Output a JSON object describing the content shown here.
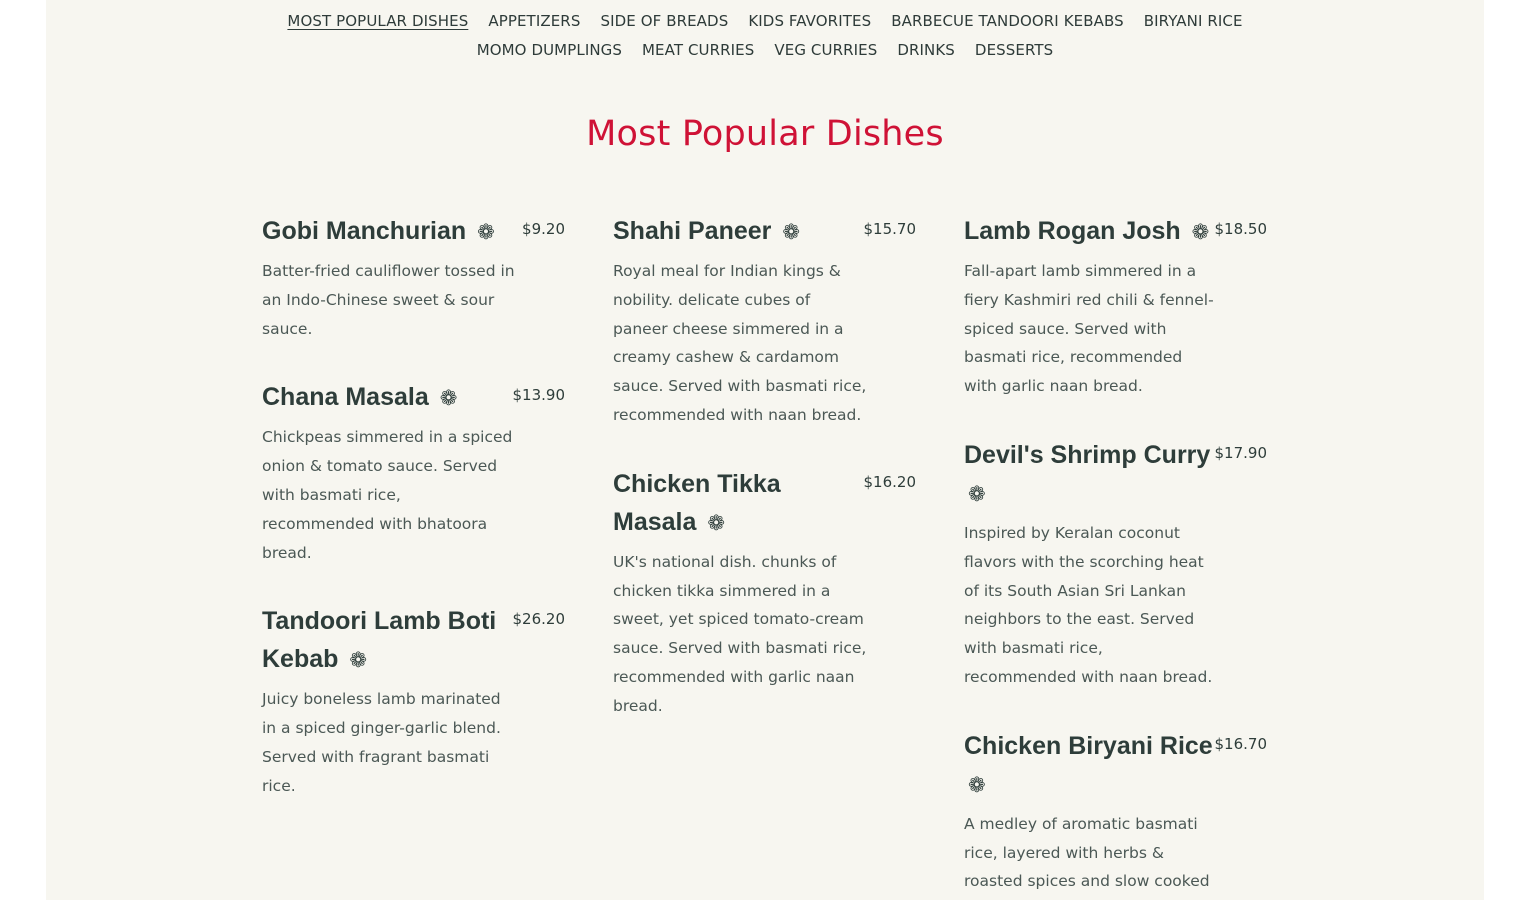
{
  "nav": {
    "row1": [
      "MOST POPULAR DISHES",
      "APPETIZERS",
      "SIDE OF BREADS",
      "KIDS FAVORITES",
      "BARBECUE TANDOORI KEBABS",
      "BIRYANI RICE"
    ],
    "row2": [
      "MOMO DUMPLINGS",
      "MEAT CURRIES",
      "VEG CURRIES",
      "DRINKS",
      "DESSERTS"
    ],
    "active": "MOST POPULAR DISHES"
  },
  "section": {
    "title": "Most Popular Dishes"
  },
  "icons": {
    "dish_marker": "flower-icon",
    "dish_marker_glyph": "❁"
  },
  "colors": {
    "title_red": "#cf1236",
    "text_dark": "#2e3d3a",
    "background": "#f7f6f0"
  },
  "menu": {
    "columns": [
      [
        {
          "name": "Gobi Manchurian",
          "price": "$9.20",
          "description": "Batter-fried cauliflower tossed in an Indo-Chinese sweet & sour sauce."
        },
        {
          "name": "Chana Masala",
          "price": "$13.90",
          "description": "Chickpeas simmered in a spiced onion & tomato sauce. Served with basmati rice, recommended with bhatoora bread."
        },
        {
          "name": "Tandoori Lamb Boti Kebab",
          "price": "$26.20",
          "description": "Juicy boneless lamb marinated in a spiced ginger-garlic blend. Served with fragrant basmati rice."
        }
      ],
      [
        {
          "name": "Shahi Paneer",
          "price": "$15.70",
          "description": "Royal meal for Indian kings & nobility. delicate cubes of paneer cheese simmered in a creamy cashew & cardamom sauce. Served with basmati rice, recommended with naan bread."
        },
        {
          "name": "Chicken Tikka Masala",
          "price": "$16.20",
          "description": "UK's national dish. chunks of chicken tikka simmered in a sweet, yet spiced tomato-cream sauce. Served with basmati rice, recommended with garlic naan bread."
        }
      ],
      [
        {
          "name": "Lamb Rogan Josh",
          "price": "$18.50",
          "description": "Fall-apart lamb simmered in a fiery Kashmiri red chili & fennel-spiced sauce. Served with basmati rice, recommended with garlic naan bread."
        },
        {
          "name": "Devil's Shrimp Curry",
          "price": "$17.90",
          "description": "Inspired by Keralan coconut flavors with the scorching heat of its South Asian Sri Lankan neighbors to the east. Served with basmati rice, recommended with naan bread."
        },
        {
          "name": "Chicken Biryani Rice",
          "price": "$16.70",
          "description": "A medley of aromatic basmati rice, layered with herbs & roasted spices and slow cooked"
        }
      ]
    ]
  }
}
